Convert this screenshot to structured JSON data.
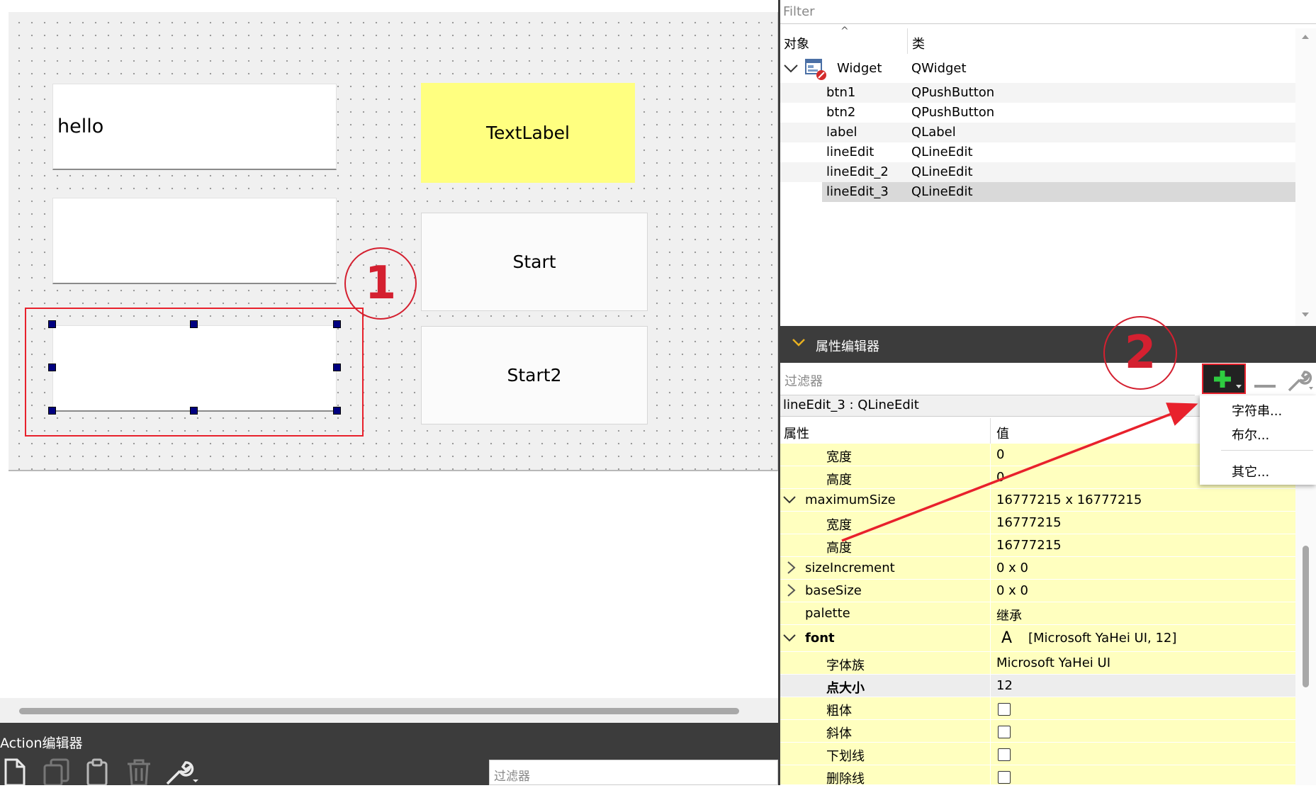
{
  "designer": {
    "lineedit1_value": "hello",
    "lineedit2_value": "",
    "lineedit3_value": "",
    "textlabel_text": "TextLabel",
    "btn1_label": "Start",
    "btn2_label": "Start2",
    "textlabel_bg": "#ffff80"
  },
  "annotations": {
    "marker1": "1",
    "marker2": "2",
    "color": "#e8212c"
  },
  "action_editor": {
    "title": "Action编辑器",
    "filter_placeholder": "过滤器",
    "icons": [
      "new-icon",
      "copy-icon",
      "paste-icon",
      "delete-icon",
      "wrench-icon"
    ]
  },
  "object_inspector": {
    "filter_placeholder": "Filter",
    "col_object": "对象",
    "col_class": "类",
    "root": {
      "name": "Widget",
      "class": "QWidget"
    },
    "children": [
      {
        "name": "btn1",
        "class": "QPushButton"
      },
      {
        "name": "btn2",
        "class": "QPushButton"
      },
      {
        "name": "label",
        "class": "QLabel"
      },
      {
        "name": "lineEdit",
        "class": "QLineEdit"
      },
      {
        "name": "lineEdit_2",
        "class": "QLineEdit"
      },
      {
        "name": "lineEdit_3",
        "class": "QLineEdit"
      }
    ],
    "selected": "lineEdit_3"
  },
  "property_editor": {
    "title": "属性编辑器",
    "filter_placeholder": "过滤器",
    "object_label": "lineEdit_3 : QLineEdit",
    "col_property": "属性",
    "col_value": "值",
    "rows": [
      {
        "name": "宽度",
        "value": "0"
      },
      {
        "name": "高度",
        "value": "0"
      },
      {
        "name": "maximumSize",
        "value": "16777215 x 16777215"
      },
      {
        "name": "宽度",
        "value": "16777215"
      },
      {
        "name": "高度",
        "value": "16777215"
      },
      {
        "name": "sizeIncrement",
        "value": "0 x 0"
      },
      {
        "name": "baseSize",
        "value": "0 x 0"
      },
      {
        "name": "palette",
        "value": "继承"
      },
      {
        "name": "font",
        "value": "[Microsoft YaHei UI, 12]"
      },
      {
        "name": "字体族",
        "value": "Microsoft YaHei UI"
      },
      {
        "name": "点大小",
        "value": "12"
      },
      {
        "name": "粗体",
        "value": ""
      },
      {
        "name": "斜体",
        "value": ""
      },
      {
        "name": "下划线",
        "value": ""
      },
      {
        "name": "删除线",
        "value": ""
      }
    ],
    "font_icon_glyph": "A",
    "add_menu": {
      "items": [
        "字符串...",
        "布尔...",
        "其它..."
      ]
    }
  }
}
